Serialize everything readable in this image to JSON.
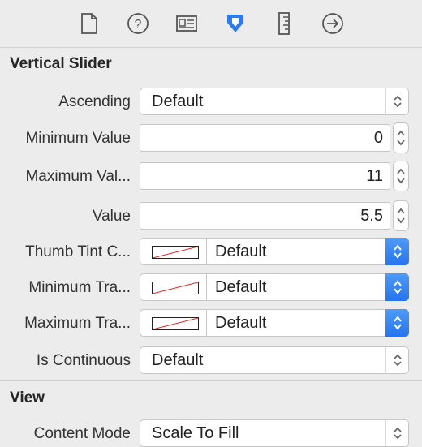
{
  "toolbar": {
    "tabs": [
      {
        "icon": "file-icon"
      },
      {
        "icon": "help-icon"
      },
      {
        "icon": "identity-icon"
      },
      {
        "icon": "attributes-icon",
        "selected": true
      },
      {
        "icon": "ruler-icon"
      },
      {
        "icon": "connections-icon"
      }
    ]
  },
  "slider_section": {
    "title": "Vertical Slider",
    "ascending": {
      "label": "Ascending",
      "value": "Default"
    },
    "minimum_value": {
      "label": "Minimum Value",
      "value": "0"
    },
    "maximum_value": {
      "label": "Maximum Val...",
      "value": "11"
    },
    "value": {
      "label": "Value",
      "value": "5.5"
    },
    "thumb_tint": {
      "label": "Thumb Tint C...",
      "value": "Default"
    },
    "minimum_track": {
      "label": "Minimum Tra...",
      "value": "Default"
    },
    "maximum_track": {
      "label": "Maximum Tra...",
      "value": "Default"
    },
    "is_continuous": {
      "label": "Is Continuous",
      "value": "Default"
    }
  },
  "view_section": {
    "title": "View",
    "content_mode": {
      "label": "Content Mode",
      "value": "Scale To Fill"
    }
  },
  "colors": {
    "accent": "#2b7cf0",
    "background": "#ececec"
  }
}
